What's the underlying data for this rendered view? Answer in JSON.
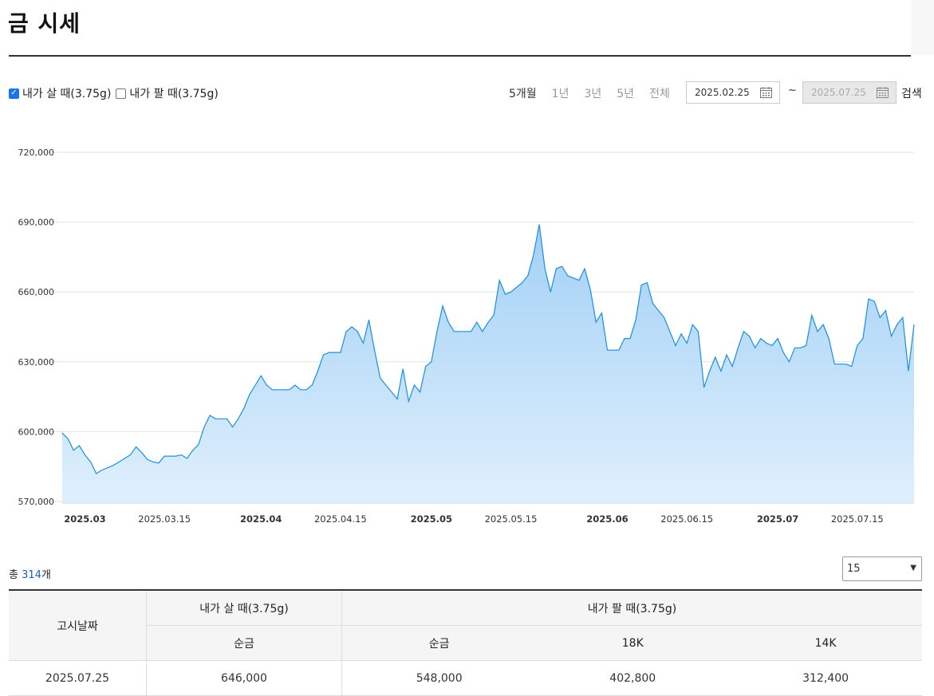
{
  "page": {
    "title": "금 시세"
  },
  "filters": {
    "buy_label": "내가 살 때(3.75g)",
    "buy_checked": true,
    "sell_label": "내가 팔 때(3.75g)",
    "sell_checked": false,
    "periods": [
      {
        "label": "5개월",
        "active": true
      },
      {
        "label": "1년",
        "active": false
      },
      {
        "label": "3년",
        "active": false
      },
      {
        "label": "5년",
        "active": false
      },
      {
        "label": "전체",
        "active": false
      }
    ],
    "date_from": "2025.02.25",
    "date_to": "2025.07.25",
    "tilde": "~",
    "search_label": "검색"
  },
  "chart_data": {
    "type": "area",
    "series": [
      {
        "name": "내가 살 때(3.75g)",
        "color": "#1a8fe3"
      }
    ],
    "y_ticks": [
      "720,000",
      "690,000",
      "660,000",
      "630,000",
      "600,000",
      "570,000"
    ],
    "ylim": [
      570000,
      720000
    ],
    "x_ticks": [
      {
        "label": "2025.03",
        "major": true
      },
      {
        "label": "2025.03.15",
        "major": false
      },
      {
        "label": "2025.04",
        "major": true
      },
      {
        "label": "2025.04.15",
        "major": false
      },
      {
        "label": "2025.05",
        "major": true
      },
      {
        "label": "2025.05.15",
        "major": false
      },
      {
        "label": "2025.06",
        "major": true
      },
      {
        "label": "2025.06.15",
        "major": false
      },
      {
        "label": "2025.07",
        "major": true
      },
      {
        "label": "2025.07.15",
        "major": false
      }
    ],
    "grid": true,
    "points": [
      [
        "2025-02-25",
        599500
      ],
      [
        "2025-02-26",
        597000
      ],
      [
        "2025-02-27",
        592000
      ],
      [
        "2025-02-28",
        594000
      ],
      [
        "2025-03-01",
        590000
      ],
      [
        "2025-03-02",
        587000
      ],
      [
        "2025-03-03",
        582000
      ],
      [
        "2025-03-04",
        583500
      ],
      [
        "2025-03-05",
        584500
      ],
      [
        "2025-03-06",
        585500
      ],
      [
        "2025-03-07",
        587000
      ],
      [
        "2025-03-08",
        588500
      ],
      [
        "2025-03-09",
        590000
      ],
      [
        "2025-03-10",
        593500
      ],
      [
        "2025-03-11",
        591000
      ],
      [
        "2025-03-12",
        588000
      ],
      [
        "2025-03-13",
        587000
      ],
      [
        "2025-03-14",
        586500
      ],
      [
        "2025-03-15",
        589500
      ],
      [
        "2025-03-16",
        589500
      ],
      [
        "2025-03-17",
        589500
      ],
      [
        "2025-03-18",
        590000
      ],
      [
        "2025-03-19",
        588500
      ],
      [
        "2025-03-20",
        592000
      ],
      [
        "2025-03-21",
        594500
      ],
      [
        "2025-03-22",
        602000
      ],
      [
        "2025-03-23",
        607000
      ],
      [
        "2025-03-24",
        605500
      ],
      [
        "2025-03-25",
        605500
      ],
      [
        "2025-03-26",
        605500
      ],
      [
        "2025-03-27",
        602000
      ],
      [
        "2025-03-28",
        605500
      ],
      [
        "2025-03-29",
        610000
      ],
      [
        "2025-03-30",
        616000
      ],
      [
        "2025-03-31",
        620000
      ],
      [
        "2025-04-01",
        624000
      ],
      [
        "2025-04-02",
        620000
      ],
      [
        "2025-04-03",
        618000
      ],
      [
        "2025-04-04",
        618000
      ],
      [
        "2025-04-05",
        618000
      ],
      [
        "2025-04-06",
        618000
      ],
      [
        "2025-04-07",
        620000
      ],
      [
        "2025-04-08",
        618000
      ],
      [
        "2025-04-09",
        618000
      ],
      [
        "2025-04-10",
        620000
      ],
      [
        "2025-04-11",
        626000
      ],
      [
        "2025-04-12",
        633000
      ],
      [
        "2025-04-13",
        634000
      ],
      [
        "2025-04-14",
        634000
      ],
      [
        "2025-04-15",
        634000
      ],
      [
        "2025-04-16",
        643000
      ],
      [
        "2025-04-17",
        645000
      ],
      [
        "2025-04-18",
        643000
      ],
      [
        "2025-04-19",
        638000
      ],
      [
        "2025-04-20",
        648000
      ],
      [
        "2025-04-21",
        635000
      ],
      [
        "2025-04-22",
        623000
      ],
      [
        "2025-04-23",
        620000
      ],
      [
        "2025-04-24",
        617000
      ],
      [
        "2025-04-25",
        614000
      ],
      [
        "2025-04-26",
        627000
      ],
      [
        "2025-04-27",
        613000
      ],
      [
        "2025-04-28",
        620000
      ],
      [
        "2025-04-29",
        617000
      ],
      [
        "2025-04-30",
        628000
      ],
      [
        "2025-05-01",
        630000
      ],
      [
        "2025-05-02",
        643000
      ],
      [
        "2025-05-03",
        654000
      ],
      [
        "2025-05-04",
        647000
      ],
      [
        "2025-05-05",
        643000
      ],
      [
        "2025-05-06",
        643000
      ],
      [
        "2025-05-07",
        643000
      ],
      [
        "2025-05-08",
        643000
      ],
      [
        "2025-05-09",
        647000
      ],
      [
        "2025-05-10",
        643000
      ],
      [
        "2025-05-11",
        647000
      ],
      [
        "2025-05-12",
        650000
      ],
      [
        "2025-05-13",
        665000
      ],
      [
        "2025-05-14",
        659000
      ],
      [
        "2025-05-15",
        660000
      ],
      [
        "2025-05-16",
        662000
      ],
      [
        "2025-05-17",
        664000
      ],
      [
        "2025-05-18",
        667000
      ],
      [
        "2025-05-19",
        676000
      ],
      [
        "2025-05-20",
        689000
      ],
      [
        "2025-05-21",
        670000
      ],
      [
        "2025-05-22",
        660000
      ],
      [
        "2025-05-23",
        670000
      ],
      [
        "2025-05-24",
        671000
      ],
      [
        "2025-05-25",
        667000
      ],
      [
        "2025-05-26",
        666000
      ],
      [
        "2025-05-27",
        665000
      ],
      [
        "2025-05-28",
        670000
      ],
      [
        "2025-05-29",
        661000
      ],
      [
        "2025-05-30",
        647000
      ],
      [
        "2025-05-31",
        651000
      ],
      [
        "2025-06-01",
        635000
      ],
      [
        "2025-06-02",
        635000
      ],
      [
        "2025-06-03",
        635000
      ],
      [
        "2025-06-04",
        640000
      ],
      [
        "2025-06-05",
        640000
      ],
      [
        "2025-06-06",
        648000
      ],
      [
        "2025-06-07",
        663000
      ],
      [
        "2025-06-08",
        664000
      ],
      [
        "2025-06-09",
        655000
      ],
      [
        "2025-06-10",
        652000
      ],
      [
        "2025-06-11",
        649000
      ],
      [
        "2025-06-12",
        643000
      ],
      [
        "2025-06-13",
        637000
      ],
      [
        "2025-06-14",
        642000
      ],
      [
        "2025-06-15",
        638000
      ],
      [
        "2025-06-16",
        646000
      ],
      [
        "2025-06-17",
        643000
      ],
      [
        "2025-06-18",
        619000
      ],
      [
        "2025-06-19",
        626000
      ],
      [
        "2025-06-20",
        632000
      ],
      [
        "2025-06-21",
        626000
      ],
      [
        "2025-06-22",
        633000
      ],
      [
        "2025-06-23",
        628000
      ],
      [
        "2025-06-24",
        636000
      ],
      [
        "2025-06-25",
        643000
      ],
      [
        "2025-06-26",
        641000
      ],
      [
        "2025-06-27",
        636000
      ],
      [
        "2025-06-28",
        640000
      ],
      [
        "2025-06-29",
        638000
      ],
      [
        "2025-06-30",
        637000
      ],
      [
        "2025-07-01",
        640000
      ],
      [
        "2025-07-02",
        634000
      ],
      [
        "2025-07-03",
        630000
      ],
      [
        "2025-07-04",
        636000
      ],
      [
        "2025-07-05",
        636000
      ],
      [
        "2025-07-06",
        637000
      ],
      [
        "2025-07-07",
        650000
      ],
      [
        "2025-07-08",
        643000
      ],
      [
        "2025-07-09",
        646000
      ],
      [
        "2025-07-10",
        640000
      ],
      [
        "2025-07-11",
        629000
      ],
      [
        "2025-07-12",
        629000
      ],
      [
        "2025-07-13",
        629000
      ],
      [
        "2025-07-14",
        628000
      ],
      [
        "2025-07-15",
        637000
      ],
      [
        "2025-07-16",
        640000
      ],
      [
        "2025-07-17",
        657000
      ],
      [
        "2025-07-18",
        656000
      ],
      [
        "2025-07-19",
        649000
      ],
      [
        "2025-07-20",
        652000
      ],
      [
        "2025-07-21",
        641000
      ],
      [
        "2025-07-22",
        646000
      ],
      [
        "2025-07-23",
        649000
      ],
      [
        "2025-07-24",
        626000
      ],
      [
        "2025-07-25",
        646000
      ]
    ]
  },
  "summary": {
    "prefix": "총 ",
    "count": "314",
    "suffix": "개"
  },
  "page_size": {
    "selected": "15"
  },
  "table": {
    "col_date": "고시날짜",
    "group_buy": "내가 살 때(3.75g)",
    "group_sell": "내가 팔 때(3.75g)",
    "sub_buy_pure": "순금",
    "sub_sell_pure": "순금",
    "sub_sell_18k": "18K",
    "sub_sell_14k": "14K",
    "rows": [
      {
        "date": "2025.07.25",
        "buy_pure": "646,000",
        "sell_pure": "548,000",
        "sell_18k": "402,800",
        "sell_14k": "312,400"
      }
    ]
  }
}
